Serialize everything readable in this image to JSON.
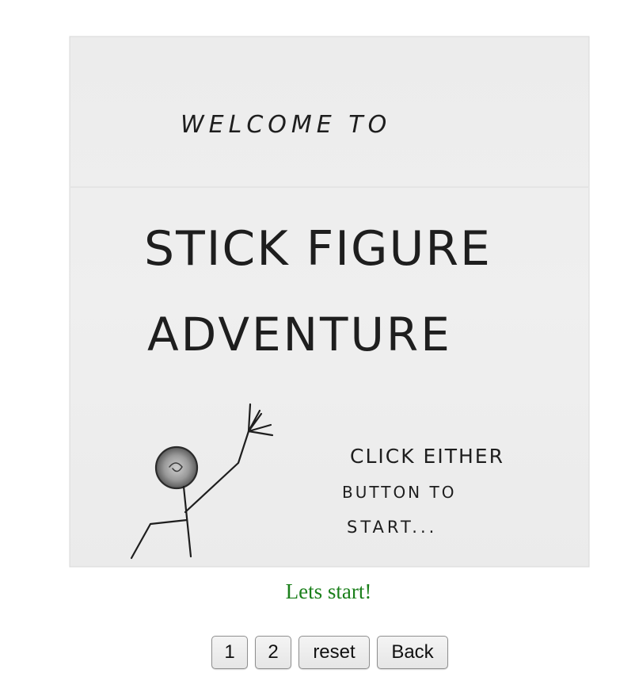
{
  "scene": {
    "welcome_text": "WELCOME TO",
    "title_line1": "STICK FIGURE",
    "title_line2": "ADVENTURE",
    "instruction_line1": "CLICK EITHER",
    "instruction_line2": "BUTTON TO",
    "instruction_line3": "START..."
  },
  "status": {
    "message": "Lets start!",
    "color": "#1a7f1a"
  },
  "controls": {
    "button_1_label": "1",
    "button_2_label": "2",
    "reset_label": "reset",
    "back_label": "Back"
  }
}
